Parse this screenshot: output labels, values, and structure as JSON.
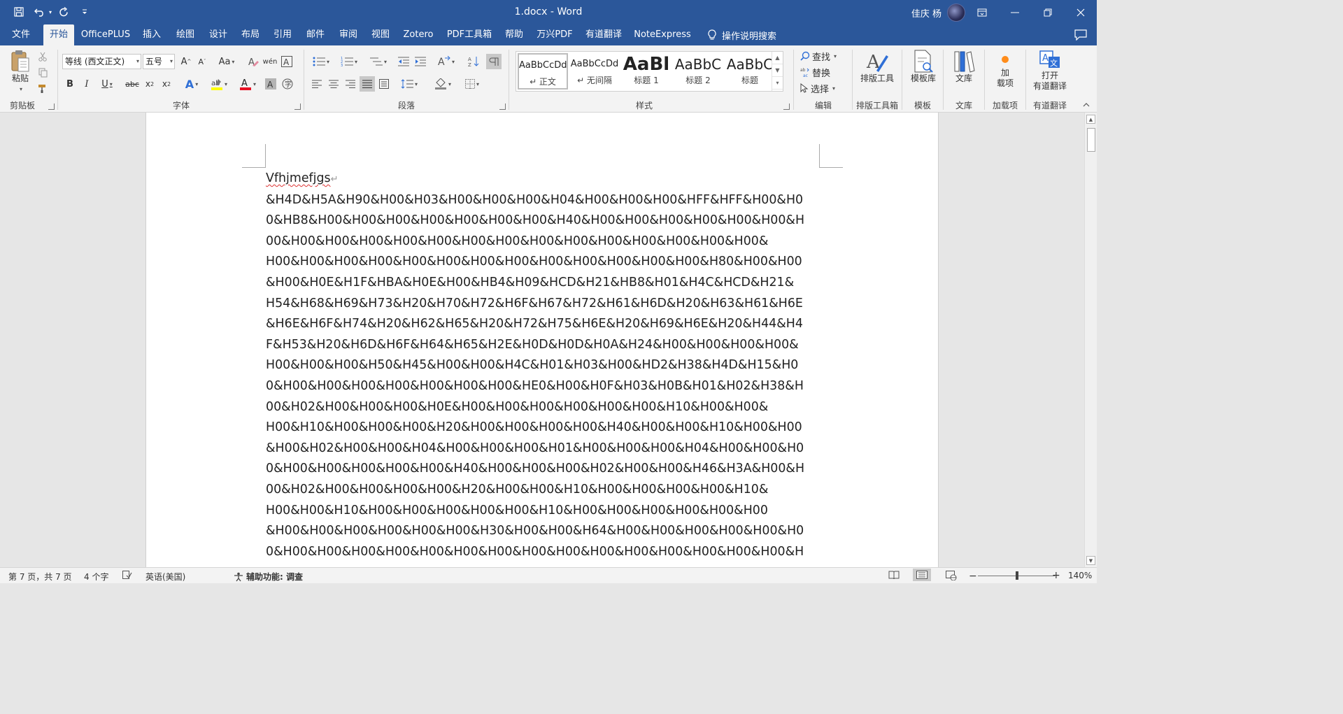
{
  "window": {
    "title": "1.docx  -  Word",
    "user_name": "佳庆 杨"
  },
  "tabs": [
    {
      "label": "文件"
    },
    {
      "label": "开始"
    },
    {
      "label": "OfficePLUS"
    },
    {
      "label": "插入"
    },
    {
      "label": "绘图"
    },
    {
      "label": "设计"
    },
    {
      "label": "布局"
    },
    {
      "label": "引用"
    },
    {
      "label": "邮件"
    },
    {
      "label": "审阅"
    },
    {
      "label": "视图"
    },
    {
      "label": "Zotero"
    },
    {
      "label": "PDF工具箱"
    },
    {
      "label": "帮助"
    },
    {
      "label": "万兴PDF"
    },
    {
      "label": "有道翻译"
    },
    {
      "label": "NoteExpress"
    }
  ],
  "active_tab": "开始",
  "tell_me": "操作说明搜索",
  "ribbon": {
    "clipboard": {
      "label": "剪贴板",
      "paste": "粘贴"
    },
    "font": {
      "label": "字体",
      "font_name": "等线 (西文正文)",
      "font_size": "五号"
    },
    "paragraph": {
      "label": "段落"
    },
    "styles": {
      "label": "样式",
      "items": [
        {
          "sample": "AaBbCcDd",
          "name": "↵ 正文"
        },
        {
          "sample": "AaBbCcDd",
          "name": "↵ 无间隔"
        },
        {
          "sample": "AaBl",
          "name": "标题 1"
        },
        {
          "sample": "AaBbC",
          "name": "标题 2"
        },
        {
          "sample": "AaBbC",
          "name": "标题"
        }
      ]
    },
    "editing": {
      "label": "编辑",
      "find": "查找",
      "replace": "替换",
      "select": "选择"
    },
    "layout_tools": {
      "label": "排版工具箱",
      "button": "排版工具"
    },
    "template": {
      "label": "模板",
      "button": "模板库"
    },
    "library": {
      "label": "文库",
      "button": "文库"
    },
    "addins": {
      "label": "加载项",
      "button_line1": "加",
      "button_line2": "载项"
    },
    "youdao": {
      "label": "有道翻译",
      "button_line1": "打开",
      "button_line2": "有道翻译"
    }
  },
  "document": {
    "lines": [
      "Vfhjmefjgs",
      "&H4D&H5A&H90&H00&H03&H00&H00&H00&H04&H00&H00&H00&HFF&HFF&H00&H0",
      "0&HB8&H00&H00&H00&H00&H00&H00&H00&H40&H00&H00&H00&H00&H00&H00&H",
      "00&H00&H00&H00&H00&H00&H00&H00&H00&H00&H00&H00&H00&H00&H00&",
      "H00&H00&H00&H00&H00&H00&H00&H00&H00&H00&H00&H00&H00&H80&H00&H00",
      "&H00&H0E&H1F&HBA&H0E&H00&HB4&H09&HCD&H21&HB8&H01&H4C&HCD&H21&",
      "H54&H68&H69&H73&H20&H70&H72&H6F&H67&H72&H61&H6D&H20&H63&H61&H6E",
      "&H6E&H6F&H74&H20&H62&H65&H20&H72&H75&H6E&H20&H69&H6E&H20&H44&H4",
      "F&H53&H20&H6D&H6F&H64&H65&H2E&H0D&H0D&H0A&H24&H00&H00&H00&H00&",
      "H00&H00&H00&H50&H45&H00&H00&H4C&H01&H03&H00&HD2&H38&H4D&H15&H0",
      "0&H00&H00&H00&H00&H00&H00&H00&HE0&H00&H0F&H03&H0B&H01&H02&H38&H",
      "00&H02&H00&H00&H00&H0E&H00&H00&H00&H00&H00&H00&H10&H00&H00&",
      "H00&H10&H00&H00&H00&H20&H00&H00&H00&H00&H40&H00&H00&H10&H00&H00",
      "&H00&H02&H00&H00&H04&H00&H00&H00&H01&H00&H00&H00&H04&H00&H00&H0",
      "0&H00&H00&H00&H00&H00&H40&H00&H00&H00&H02&H00&H00&H46&H3A&H00&H",
      "00&H02&H00&H00&H00&H00&H20&H00&H00&H10&H00&H00&H00&H00&H10&",
      "H00&H00&H10&H00&H00&H00&H00&H00&H10&H00&H00&H00&H00&H00&H00",
      "&H00&H00&H00&H00&H00&H00&H30&H00&H00&H64&H00&H00&H00&H00&H00&H0",
      "0&H00&H00&H00&H00&H00&H00&H00&H00&H00&H00&H00&H00&H00&H00&H00&H"
    ]
  },
  "status": {
    "page": "第 7 页，共 7 页",
    "words": "4 个字",
    "language": "英语(美国)",
    "accessibility": "辅助功能: 调查",
    "zoom": "140%"
  },
  "colors": {
    "brand": "#2b579a",
    "font_color": "#e81123",
    "highlight": "#ffff00"
  }
}
